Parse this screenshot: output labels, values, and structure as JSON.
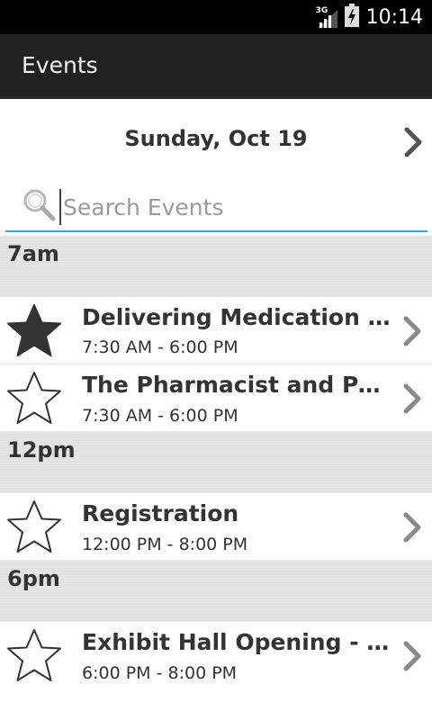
{
  "status_bar": {
    "network": "3G",
    "time": "10:14"
  },
  "action_bar": {
    "title": "Events"
  },
  "date_nav": {
    "date": "Sunday, Oct 19"
  },
  "search": {
    "placeholder": "Search Events",
    "value": ""
  },
  "groups": [
    {
      "label": "7am",
      "events": [
        {
          "title": "Delivering Medication Ther…",
          "time": "7:30 AM - 6:00 PM",
          "starred": true
        },
        {
          "title": "The Pharmacist and Patie…",
          "time": "7:30 AM - 6:00 PM",
          "starred": false
        }
      ]
    },
    {
      "label": "12pm",
      "events": [
        {
          "title": "Registration",
          "time": "12:00 PM - 8:00 PM",
          "starred": false
        }
      ]
    },
    {
      "label": "6pm",
      "events": [
        {
          "title": "Exhibit Hall Opening - Mee…",
          "time": "6:00 PM - 8:00 PM",
          "starred": false
        }
      ]
    }
  ],
  "colors": {
    "status_bar": "#000000",
    "action_bar": "#212121",
    "search_underline": "#2eaad6",
    "group_header": "#e2e2e2",
    "text": "#333333",
    "chevron": "#8a8a8a"
  },
  "icons": {
    "signal": "signal-bars-icon",
    "battery": "battery-charging-icon",
    "next": "chevron-right-icon",
    "search": "magnifier-icon",
    "star_filled": "star-filled-icon",
    "star_outline": "star-outline-icon"
  }
}
